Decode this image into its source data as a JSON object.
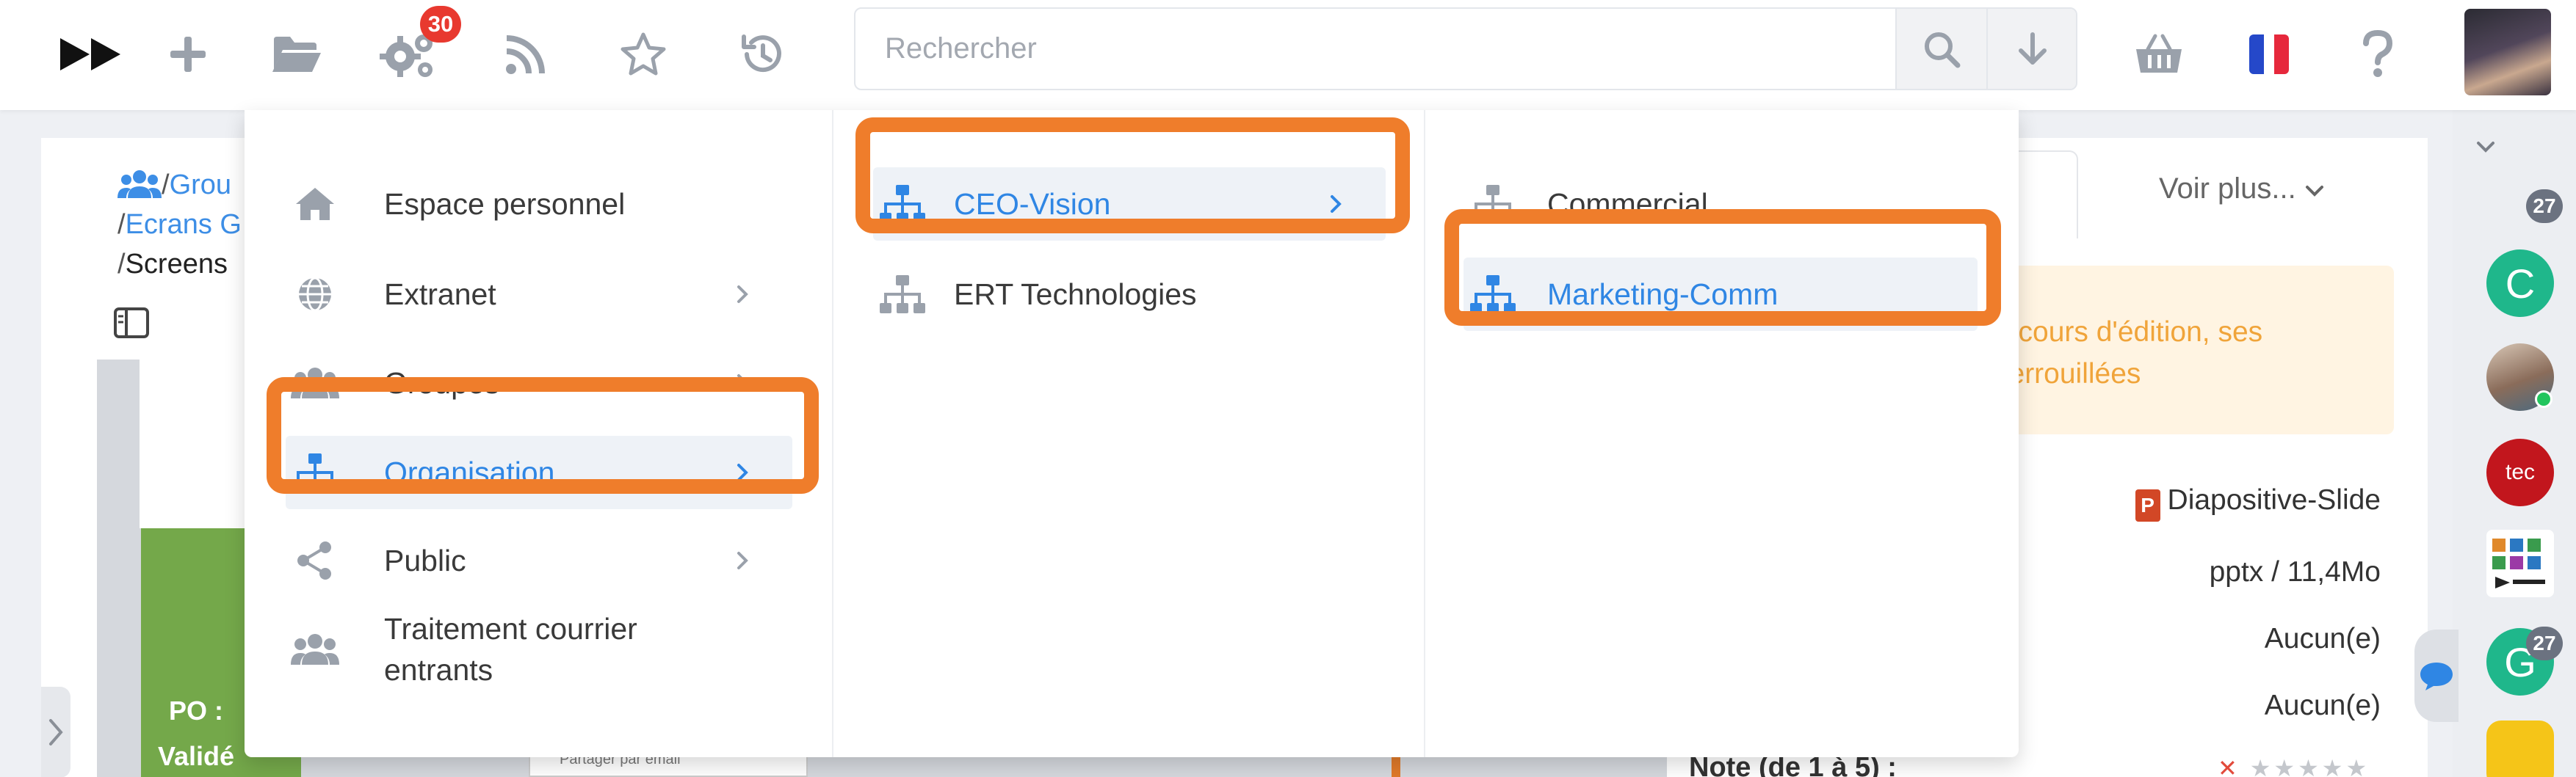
{
  "topbar": {
    "logo": "fast-forward-logo",
    "icons": [
      "plus-icon",
      "folder-open-icon",
      "gears-icon",
      "rss-icon",
      "star-icon",
      "history-icon"
    ],
    "notification_count": "30",
    "search_placeholder": "Rechercher",
    "right_icons": [
      "basket-icon",
      "french-flag-icon",
      "help-icon"
    ],
    "colors": {
      "accent": "#2f86e4",
      "badge": "#e8392f",
      "highlight": "#ef7d2b"
    }
  },
  "breadcrumb": {
    "sep": "/",
    "item1": "Grou",
    "item2": "Ecrans G",
    "item3": "Screens"
  },
  "menu": {
    "col1": [
      {
        "label": "Espace personnel",
        "icon": "home-icon",
        "has_submenu": false
      },
      {
        "label": "Extranet",
        "icon": "globe-icon",
        "has_submenu": true
      },
      {
        "label": "Groupes",
        "icon": "users-icon",
        "has_submenu": true
      },
      {
        "label": "Organisation",
        "icon": "sitemap-icon",
        "has_submenu": true,
        "active": true
      },
      {
        "label": "Public",
        "icon": "share-icon",
        "has_submenu": true
      },
      {
        "label": "Traitement courrier entrants",
        "icon": "users-icon",
        "has_submenu": false
      }
    ],
    "col2": [
      {
        "label": "CEO-Vision",
        "icon": "sitemap-icon",
        "has_submenu": true,
        "active": true
      },
      {
        "label": "ERT Technologies",
        "icon": "sitemap-icon",
        "has_submenu": false
      }
    ],
    "col3": [
      {
        "label": "Commercial",
        "icon": "sitemap-icon",
        "has_submenu": false
      },
      {
        "label": "Marketing-Comm",
        "icon": "sitemap-icon",
        "has_submenu": false,
        "active": true
      }
    ]
  },
  "panel": {
    "voir_plus": "Voir plus...",
    "notice_line1": "n cours d'édition, ses",
    "notice_line2": "verrouillées",
    "type": "Diapositive-Slide",
    "format": "pptx / 11,4Mo",
    "row3": "Aucun(e)",
    "row4": "Aucun(e)",
    "note_label": "Note (de 1 à 5) :",
    "rating": 0
  },
  "doc": {
    "green_line1": "PO :",
    "green_line2": "Validé",
    "share_text": "Partager par email"
  },
  "rail": {
    "c_letter": "C",
    "g_letter": "G",
    "count1": "27",
    "count2": "27",
    "tec_text": "tec"
  }
}
